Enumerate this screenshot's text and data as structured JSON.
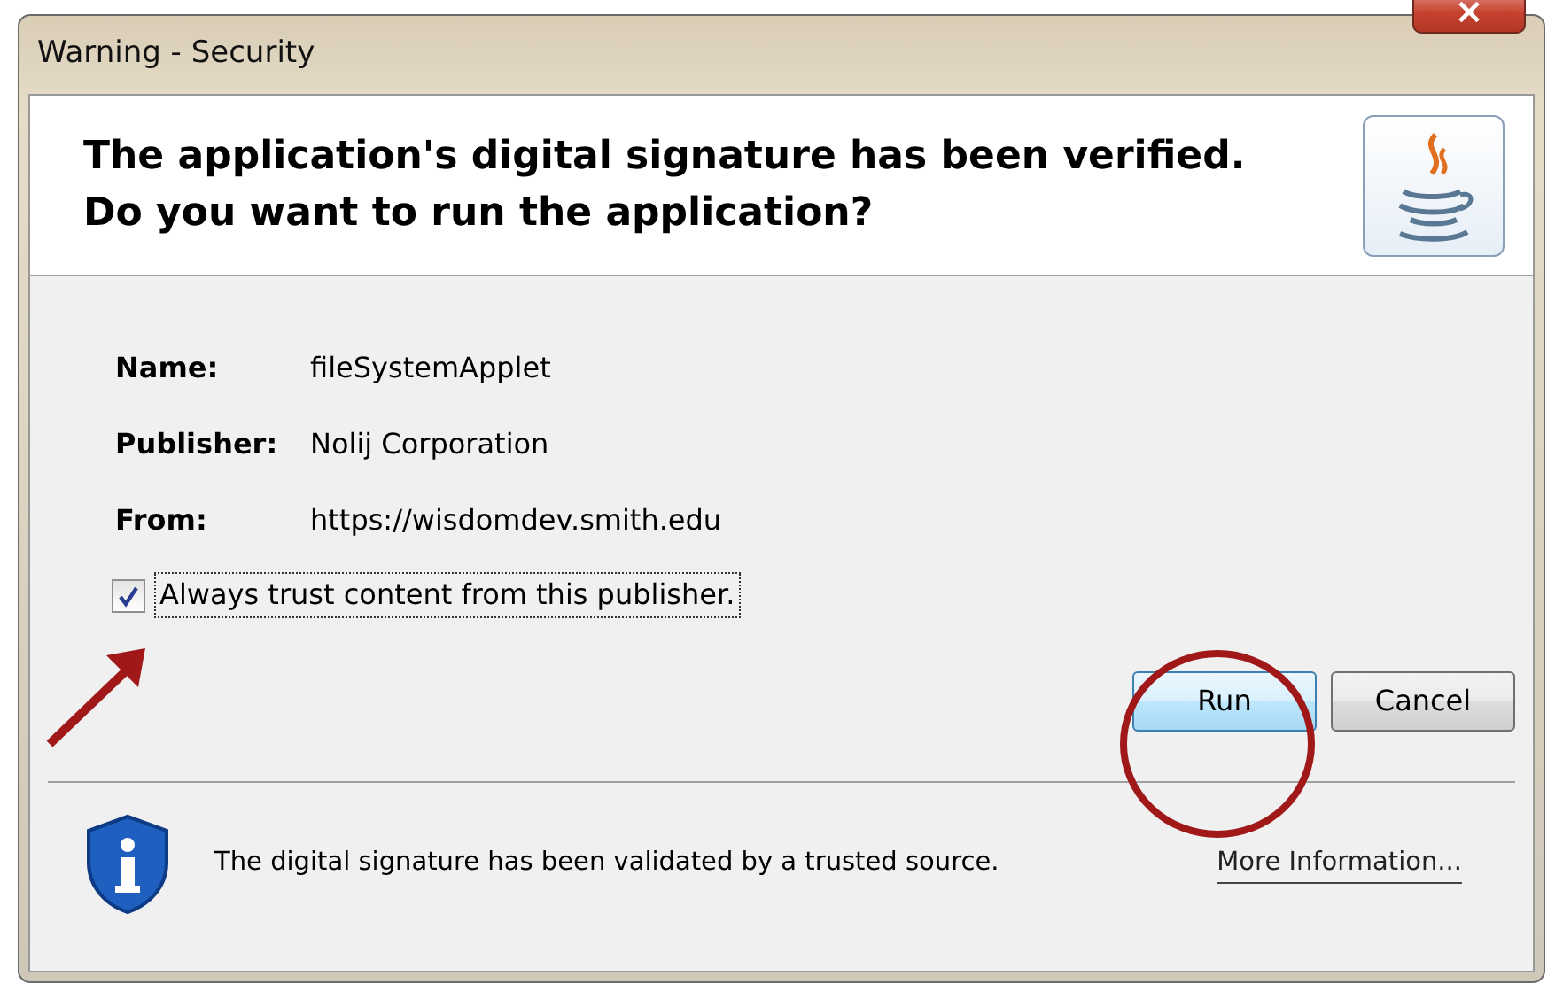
{
  "window": {
    "title": "Warning - Security",
    "close": "×"
  },
  "header": {
    "lines": [
      "The application's digital signature has been verified.",
      "Do you want to run the application?"
    ]
  },
  "details": [
    {
      "label": "Name:",
      "value": "fileSystemApplet"
    },
    {
      "label": "Publisher:",
      "value": "Nolij Corporation"
    },
    {
      "label": "From:",
      "value": "https://wisdomdev.smith.edu"
    }
  ],
  "trust_checkbox": {
    "label": "Always trust content from this publisher.",
    "checked": true
  },
  "buttons": [
    {
      "label": "Run",
      "kind": "default"
    },
    {
      "label": "Cancel",
      "kind": "normal"
    }
  ],
  "footer": {
    "message": "The digital signature has been validated by a trusted source.",
    "link": "More Information..."
  }
}
